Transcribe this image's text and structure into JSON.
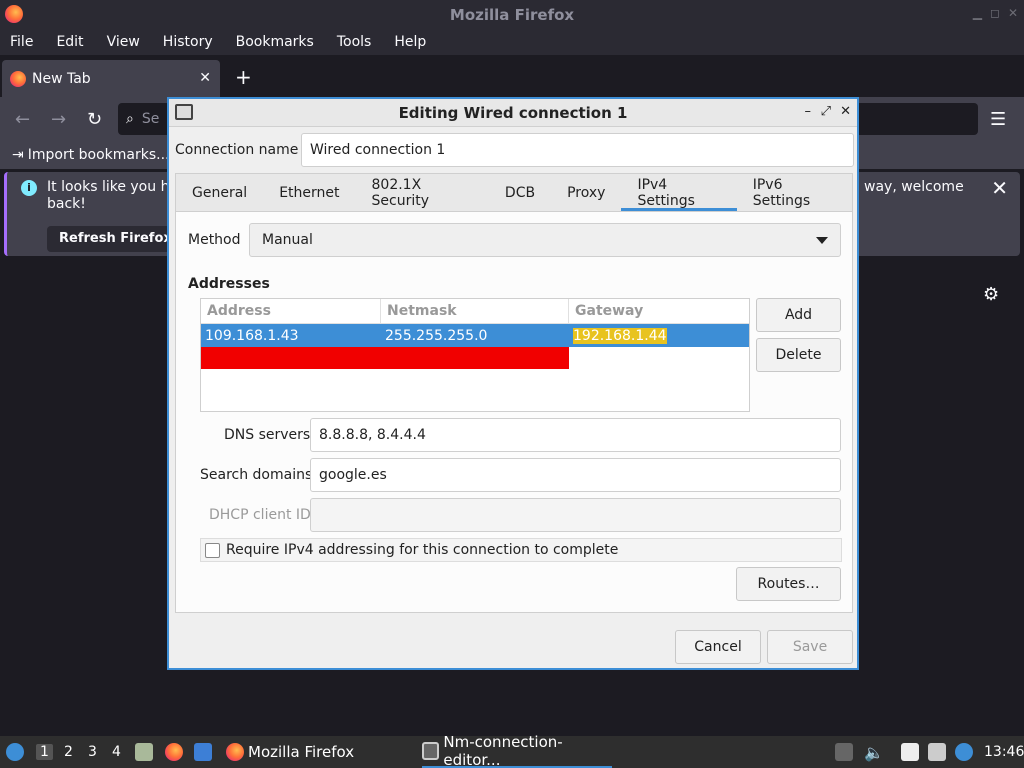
{
  "firefox": {
    "window_title": "Mozilla Firefox",
    "menu": [
      "File",
      "Edit",
      "View",
      "History",
      "Bookmarks",
      "Tools",
      "Help"
    ],
    "tab_title": "New Tab",
    "tab_close": "✕",
    "new_tab": "+",
    "url_placeholder": "Se",
    "bookmarks_item": "Import bookmarks...",
    "info_text_line1": "It looks like you ha",
    "info_text_line2": "back!",
    "info_text_tail": "way, welcome",
    "refresh_button": "Refresh Firefox..."
  },
  "dialog": {
    "title": "Editing Wired connection 1",
    "connection_name_label": "Connection name",
    "connection_name_value": "Wired connection 1",
    "tabs": [
      "General",
      "Ethernet",
      "802.1X Security",
      "DCB",
      "Proxy",
      "IPv4 Settings",
      "IPv6 Settings"
    ],
    "active_tab": "IPv4 Settings",
    "method_label": "Method",
    "method_value": "Manual",
    "addresses_label": "Addresses",
    "columns": [
      "Address",
      "Netmask",
      "Gateway"
    ],
    "rows": [
      {
        "address": "109.168.1.43",
        "netmask": "255.255.255.0",
        "gateway": "192.168.1.44"
      }
    ],
    "add_button": "Add",
    "delete_button": "Delete",
    "dns_label": "DNS servers",
    "dns_value": "8.8.8.8, 8.4.4.4",
    "search_domains_label": "Search domains",
    "search_domains_value": "google.es",
    "dhcp_label": "DHCP client ID",
    "dhcp_value": "",
    "require_ipv4_label": "Require IPv4 addressing for this connection to complete",
    "routes_button": "Routes…",
    "cancel_button": "Cancel",
    "save_button": "Save"
  },
  "taskbar": {
    "workspaces": [
      "1",
      "2",
      "3",
      "4"
    ],
    "firefox_task": "Mozilla Firefox",
    "nm_task": "Nm-connection-editor...",
    "clock": "13:46"
  }
}
